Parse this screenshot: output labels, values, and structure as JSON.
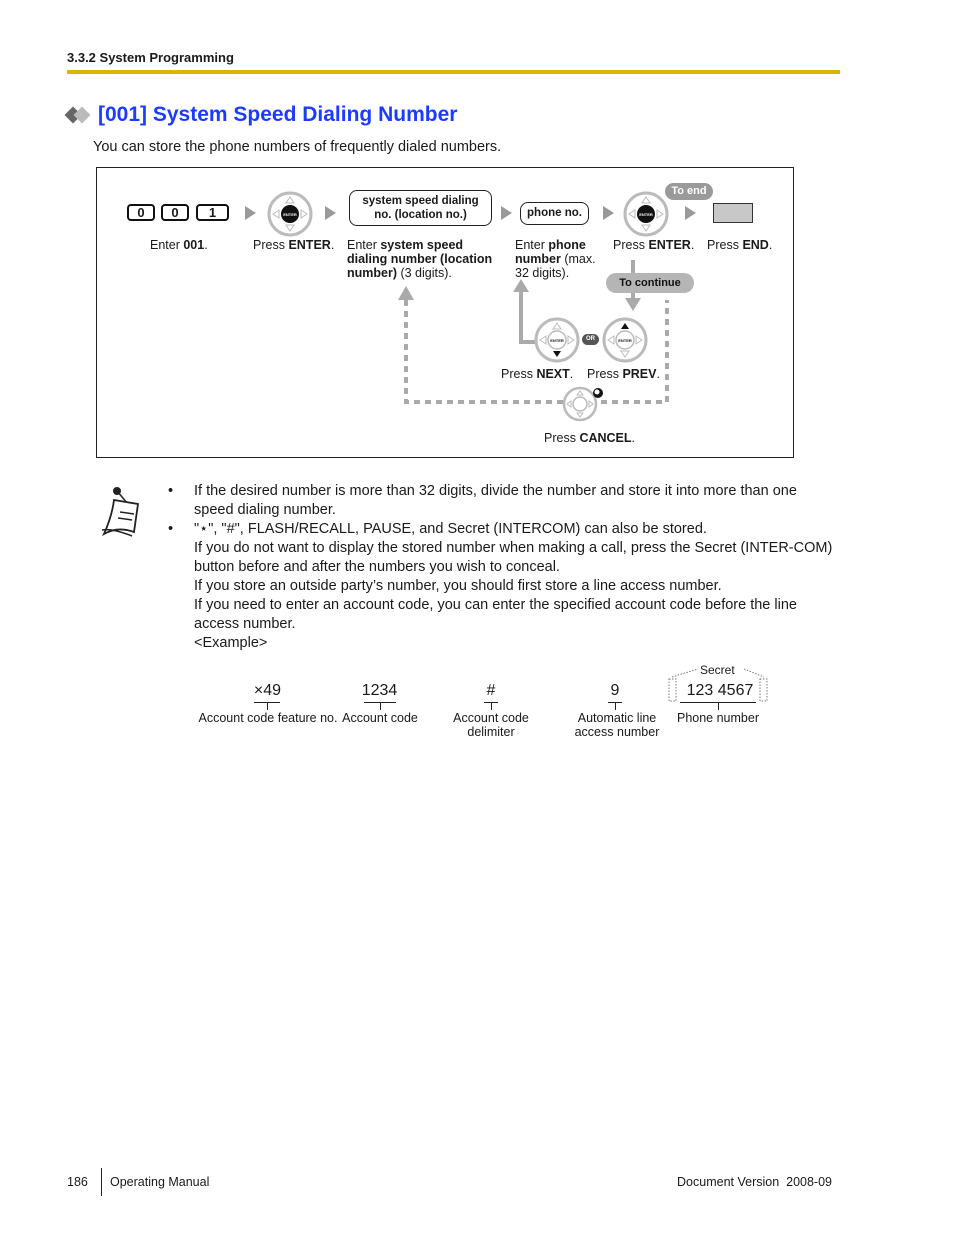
{
  "header": {
    "section": "3.3.2 System Programming"
  },
  "title": "[001] System Speed Dialing Number",
  "intro": "You can store the phone numbers of frequently dialed numbers.",
  "flow": {
    "keys": [
      "0",
      "0",
      "1"
    ],
    "steps": [
      {
        "caption_pre": "Enter ",
        "caption_bold": "001",
        "caption_post": "."
      },
      {
        "caption_pre": "Press ",
        "caption_bold": "ENTER",
        "caption_post": "."
      },
      {
        "caption_pre": "Enter ",
        "caption_bold": "system speed dialing number (location number)",
        "caption_post": " (3 digits)."
      },
      {
        "caption_pre": "Enter ",
        "caption_bold": "phone number",
        "caption_post": " (max. 32 digits)."
      },
      {
        "caption_pre": "Press ",
        "caption_bold": "ENTER",
        "caption_post": "."
      },
      {
        "caption_pre": "Press ",
        "caption_bold": "END",
        "caption_post": "."
      }
    ],
    "box_location": "system speed dialing no. (location no.)",
    "box_location_line1": "system speed dialing",
    "box_location_line2": "no. (location no.)",
    "box_phone": "phone no.",
    "enter_key_label": "ENTER",
    "to_end": "To end",
    "to_continue": "To continue",
    "or_label": "OR",
    "next": {
      "pre": "Press ",
      "bold": "NEXT",
      "post": "."
    },
    "prev": {
      "pre": "Press ",
      "bold": "PREV",
      "post": "."
    },
    "cancel": {
      "pre": "Press ",
      "bold": "CANCEL",
      "post": "."
    }
  },
  "notes": {
    "bullet": "•",
    "items": [
      {
        "lines": [
          "If the desired number is more than 32 digits, divide the number and store it into more than one speed dialing number."
        ]
      },
      {
        "lines": [
          "\"⋆\", \"#\", FLASH/RECALL, PAUSE, and Secret (INTERCOM) can also be stored.",
          "If you do not want to display the stored number when making a call, press the Secret (INTER-COM) button before and after the numbers you wish to conceal.",
          "If you store an outside party’s number, you should first store a line access number.",
          "If you need to enter an account code, you can enter the specified account code before the line access number.",
          "<Example>"
        ]
      }
    ]
  },
  "example": {
    "secret_label": "Secret",
    "parts": [
      {
        "value": "×49",
        "label": "Account code feature no."
      },
      {
        "value": "1234",
        "label": "Account code"
      },
      {
        "value": "#",
        "label": "Account code delimiter"
      },
      {
        "value": "9",
        "label": "Automatic line access number"
      },
      {
        "value": "123  4567",
        "label": "Phone number"
      }
    ]
  },
  "footer": {
    "page": "186",
    "manual": "Operating Manual",
    "version": "Document Version  2008-09"
  },
  "colors": {
    "rule": "#dcb400",
    "title": "#1a3cff",
    "arrow": "#999999"
  }
}
